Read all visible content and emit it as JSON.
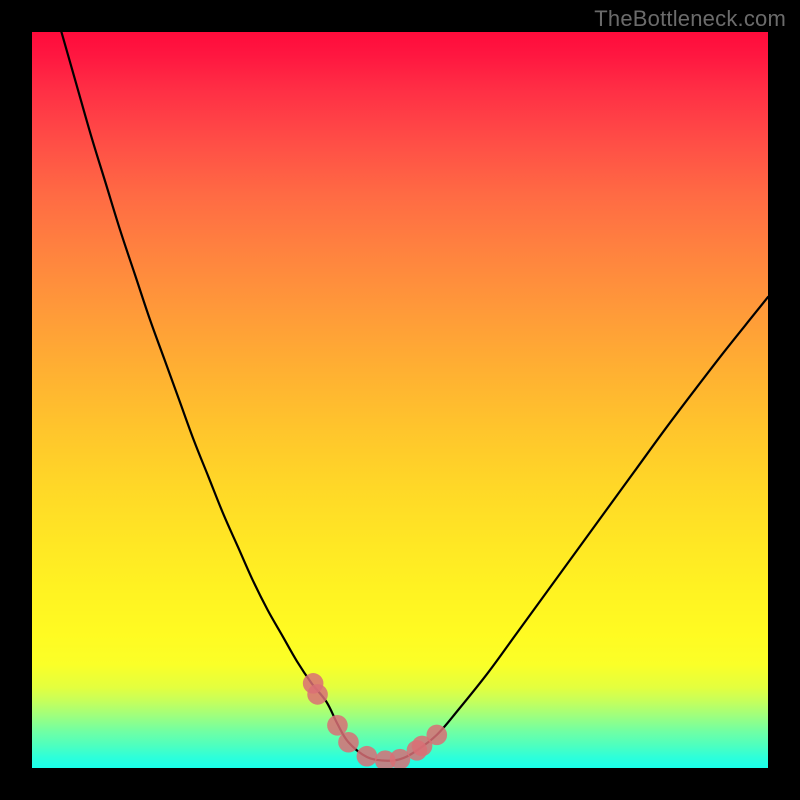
{
  "watermark": "TheBottleneck.com",
  "colors": {
    "frame": "#000000",
    "gradient_top": "#ff0b3b",
    "gradient_mid": "#ffe824",
    "gradient_bottom": "#19ffea",
    "curve": "#000000",
    "markers": "#d96f75"
  },
  "chart_data": {
    "type": "line",
    "title": "",
    "xlabel": "",
    "ylabel": "",
    "xlim": [
      0,
      100
    ],
    "ylim": [
      0,
      100
    ],
    "series": [
      {
        "name": "bottleneck-curve",
        "x": [
          4,
          6,
          8,
          10,
          12,
          14,
          16,
          18,
          20,
          22,
          24,
          26,
          28,
          30,
          32,
          34,
          36,
          38,
          40,
          41.5,
          43,
          45.5,
          48,
          50,
          52,
          55,
          58,
          62,
          66,
          70,
          74,
          78,
          82,
          86,
          90,
          94,
          98,
          100
        ],
        "y": [
          100,
          93,
          86,
          79.5,
          73,
          67,
          61,
          55.5,
          50,
          44.5,
          39.5,
          34.5,
          30,
          25.5,
          21.5,
          18,
          14.5,
          11.5,
          9,
          6,
          3.5,
          1.5,
          1,
          1.2,
          2.2,
          4.5,
          8,
          13,
          18.5,
          24,
          29.5,
          35,
          40.5,
          46,
          51.3,
          56.5,
          61.5,
          64
        ]
      }
    ],
    "markers": {
      "name": "highlight-points",
      "shape": "circle",
      "radius": 1.4,
      "x": [
        38.2,
        38.8,
        41.5,
        43.0,
        45.5,
        48.0,
        50.0,
        52.3,
        53.0,
        55.0
      ],
      "y": [
        11.5,
        10.0,
        5.8,
        3.5,
        1.6,
        1.0,
        1.2,
        2.4,
        3.0,
        4.5
      ]
    },
    "annotations": [
      {
        "text": "TheBottleneck.com",
        "position": "top-right"
      }
    ]
  }
}
